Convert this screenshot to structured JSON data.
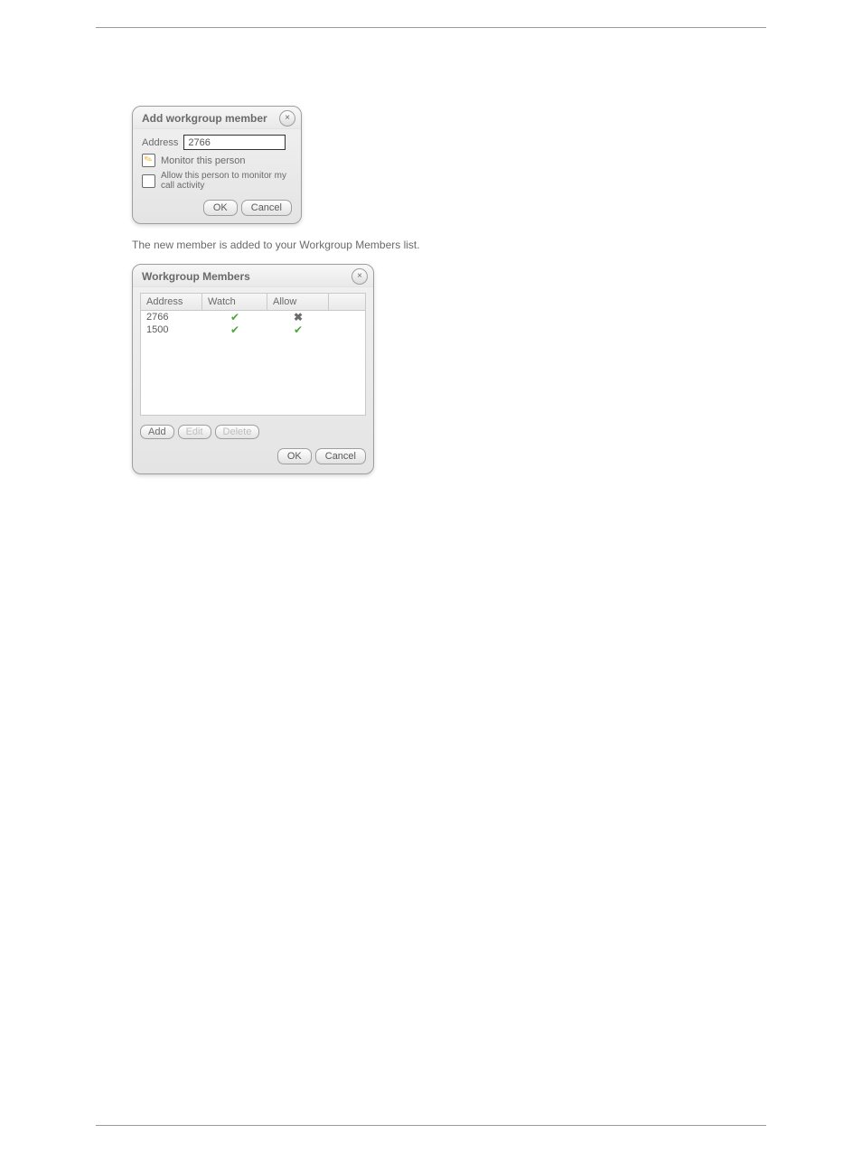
{
  "dialog1": {
    "title": "Add workgroup member",
    "address_label": "Address",
    "address_value": "2766",
    "monitor_label": "Monitor this person",
    "allow_label": "Allow this person to monitor my call activity",
    "ok": "OK",
    "cancel": "Cancel"
  },
  "caption": "The new member is added to your Workgroup Members list.",
  "dialog2": {
    "title": "Workgroup Members",
    "columns": {
      "address": "Address",
      "watch": "Watch",
      "allow": "Allow"
    },
    "rows": [
      {
        "address": "2766",
        "watch": true,
        "allow": false
      },
      {
        "address": "1500",
        "watch": true,
        "allow": true
      }
    ],
    "add": "Add",
    "edit": "Edit",
    "delete": "Delete",
    "ok": "OK",
    "cancel": "Cancel"
  }
}
